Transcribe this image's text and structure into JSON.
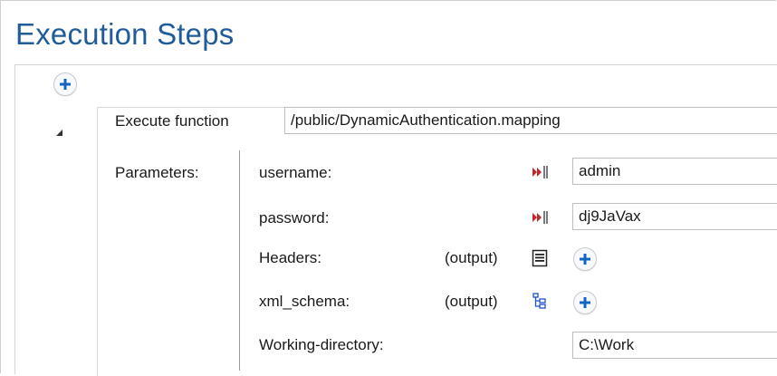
{
  "title": "Execution Steps",
  "step": {
    "label": "Execute function",
    "function_path": "/public/DynamicAuthentication.mapping",
    "parameters_label": "Parameters:",
    "params": [
      {
        "name": "username:",
        "value": "admin",
        "icon": "input-parameter-icon"
      },
      {
        "name": "password:",
        "value": "dj9JaVax",
        "icon": "input-parameter-icon"
      },
      {
        "name": "Headers:",
        "output_label": "(output)",
        "icon": "document-list-icon"
      },
      {
        "name": "xml_schema:",
        "output_label": "(output)",
        "icon": "xml-tree-icon"
      },
      {
        "name": "Working-directory:",
        "value": "C:\\Work"
      }
    ]
  },
  "colors": {
    "title": "#1f5c99",
    "plus": "#1565c0",
    "input_icon": "#c0272d"
  }
}
